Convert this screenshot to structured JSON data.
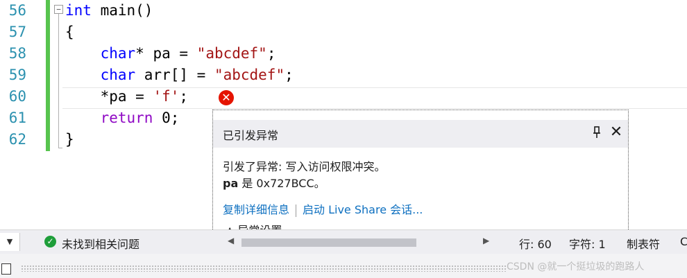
{
  "editor": {
    "lines": [
      {
        "num": "56",
        "tokens": [
          {
            "t": "int",
            "c": "kw"
          },
          {
            "t": " main()",
            "c": "plain"
          }
        ]
      },
      {
        "num": "57",
        "tokens": [
          {
            "t": "{",
            "c": "plain"
          }
        ]
      },
      {
        "num": "58",
        "tokens": [
          {
            "t": "    ",
            "c": "plain"
          },
          {
            "t": "char",
            "c": "kw"
          },
          {
            "t": "* pa = ",
            "c": "plain"
          },
          {
            "t": "\"abcdef\"",
            "c": "str"
          },
          {
            "t": ";",
            "c": "plain"
          }
        ]
      },
      {
        "num": "59",
        "tokens": [
          {
            "t": "    ",
            "c": "plain"
          },
          {
            "t": "char",
            "c": "kw"
          },
          {
            "t": " arr[] = ",
            "c": "plain"
          },
          {
            "t": "\"abcdef\"",
            "c": "str"
          },
          {
            "t": ";",
            "c": "plain"
          }
        ]
      },
      {
        "num": "60",
        "tokens": [
          {
            "t": "    *pa = ",
            "c": "plain"
          },
          {
            "t": "'f'",
            "c": "str"
          },
          {
            "t": ";",
            "c": "plain"
          }
        ]
      },
      {
        "num": "61",
        "tokens": [
          {
            "t": "    ",
            "c": "plain"
          },
          {
            "t": "return",
            "c": "ctl"
          },
          {
            "t": " 0;",
            "c": "plain"
          }
        ]
      },
      {
        "num": "62",
        "tokens": [
          {
            "t": "}",
            "c": "plain"
          }
        ]
      }
    ],
    "fold_symbol": "−",
    "error_icon": "error-icon"
  },
  "exception_popup": {
    "title": "已引发异常",
    "pin_glyph": "📌",
    "close_glyph": "✕",
    "message": "引发了异常: 写入访问权限冲突。",
    "var_name": "pa",
    "var_rest": " 是 0x727BCC。",
    "link_copy": "复制详细信息",
    "link_liveshare": "启动 Live Share 会话...",
    "settings_label": "▲ 异常设置"
  },
  "status_bar": {
    "dropdown_glyph": "▼",
    "issues_text": "未找到相关问题",
    "line": "行: 60",
    "char": "字符: 1",
    "tab": "制表符",
    "more": "C"
  },
  "watermark": "CSDN @就一个挺垃圾的跑路人",
  "colors": {
    "error": "#e51400",
    "ok": "#1e9e3a",
    "link": "#0e70c0",
    "change_bar": "#57c44e"
  }
}
